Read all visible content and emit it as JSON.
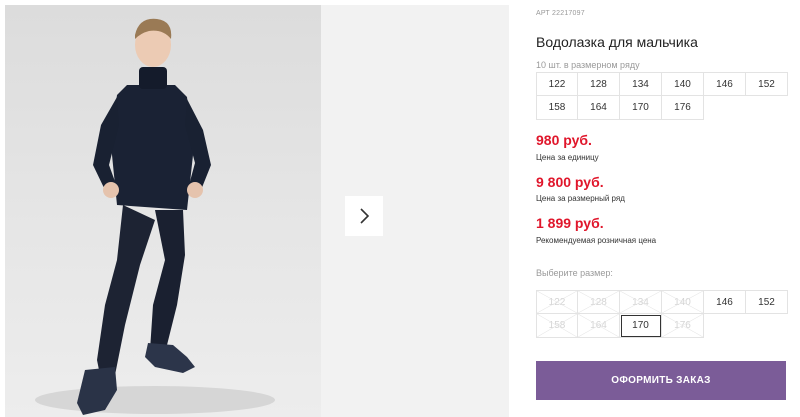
{
  "product": {
    "sku": "АРТ 22217097",
    "title": "Водолазка для мальчика",
    "pack_note": "10 шт. в размерном ряду",
    "pack_sizes": [
      "122",
      "128",
      "134",
      "140",
      "146",
      "152",
      "158",
      "164",
      "170",
      "176"
    ]
  },
  "prices": [
    {
      "value": "980 руб.",
      "note": "Цена за единицу"
    },
    {
      "value": "9 800 руб.",
      "note": "Цена за размерный ряд"
    },
    {
      "value": "1 899 руб.",
      "note": "Рекомендуемая розничная цена"
    }
  ],
  "size_picker": {
    "label": "Выберите размер:",
    "sizes": [
      {
        "label": "122",
        "available": false
      },
      {
        "label": "128",
        "available": false
      },
      {
        "label": "134",
        "available": false
      },
      {
        "label": "140",
        "available": false
      },
      {
        "label": "146",
        "available": true
      },
      {
        "label": "152",
        "available": true
      },
      {
        "label": "158",
        "available": false
      },
      {
        "label": "164",
        "available": false
      },
      {
        "label": "170",
        "available": true,
        "selected": true
      },
      {
        "label": "176",
        "available": false
      }
    ]
  },
  "actions": {
    "order_label": "ОФОРМИТЬ ЗАКАЗ"
  },
  "gallery": {
    "next_icon": "chevron-right-icon"
  },
  "colors": {
    "price": "#e0162b",
    "button": "#7b5c98"
  }
}
